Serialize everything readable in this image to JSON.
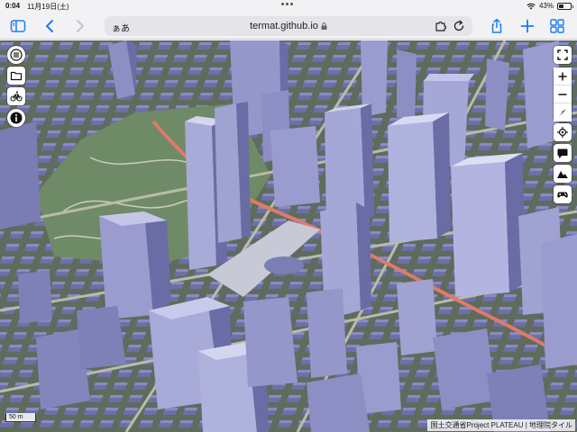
{
  "status_bar": {
    "time": "0:04",
    "date": "11月19日(土)",
    "battery_percent": "43%",
    "battery_level": 0.43
  },
  "toolbar": {
    "address_aa": "ぁあ",
    "url": "termat.github.io",
    "icons": [
      "sidebar-icon",
      "back-icon",
      "forward-icon",
      "extension-icon",
      "reload-icon",
      "share-icon",
      "new-tab-icon",
      "tabs-icon"
    ]
  },
  "map": {
    "left_controls": [
      "menu-icon",
      "folder-icon",
      "bicycle-icon",
      "info-icon"
    ],
    "right_controls": [
      "fullscreen-icon",
      "zoom-in-icon",
      "zoom-out-icon",
      "compass-icon",
      "locate-icon",
      "comment-icon",
      "terrain-icon",
      "gamepad-icon"
    ],
    "scale_label": "50 m",
    "attribution": "国土交通省Project PLATEAU | 地理院タイル",
    "colors": {
      "building": "#8d8fc4",
      "building_dark": "#6a6ca6",
      "building_light": "#b7b9e0",
      "road_highlight": "#e07a6a",
      "park": "#6f8a66"
    }
  }
}
